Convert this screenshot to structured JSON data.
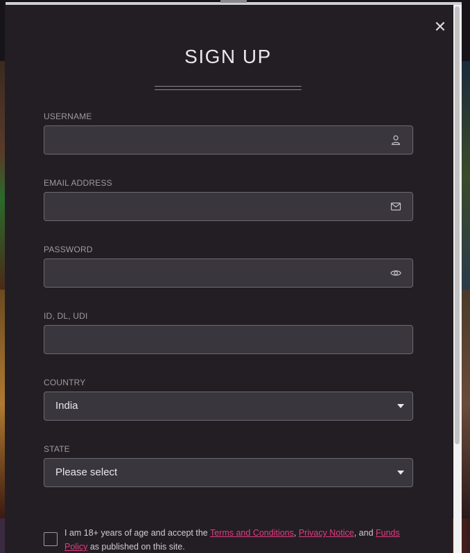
{
  "modal": {
    "title": "SIGN UP",
    "close_glyph": "✕"
  },
  "fields": {
    "username": {
      "label": "USERNAME",
      "value": "",
      "icon": "user-icon"
    },
    "email": {
      "label": "EMAIL ADDRESS",
      "value": "",
      "icon": "envelope-icon"
    },
    "password": {
      "label": "PASSWORD",
      "value": "",
      "icon": "eye-icon"
    },
    "id": {
      "label": "ID, DL, UDI",
      "value": ""
    },
    "country": {
      "label": "COUNTRY",
      "selected": "India"
    },
    "state": {
      "label": "STATE",
      "selected": "Please select"
    }
  },
  "terms": {
    "prefix": "I am 18+ years of age and accept the ",
    "link_terms": "Terms and Conditions",
    "sep1": ", ",
    "link_privacy": "Privacy Notice",
    "sep2": ", and ",
    "link_funds": "Funds Policy",
    "suffix": " as published on this site."
  },
  "colors": {
    "modal_bg": "#231e24",
    "input_bg": "#3a363d",
    "link": "#e23d82"
  }
}
